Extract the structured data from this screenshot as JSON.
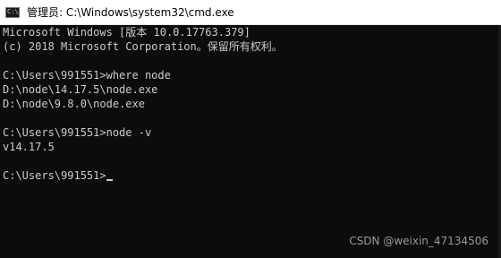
{
  "window": {
    "title": "管理员: C:\\Windows\\system32\\cmd.exe",
    "icon": "cmd-icon"
  },
  "console": {
    "lines": [
      "Microsoft Windows [版本 10.0.17763.379]",
      "(c) 2018 Microsoft Corporation。保留所有权利。",
      "",
      "C:\\Users\\991551>where node",
      "D:\\node\\14.17.5\\node.exe",
      "D:\\node\\9.8.0\\node.exe",
      "",
      "C:\\Users\\991551>node -v",
      "v14.17.5",
      "",
      "C:\\Users\\991551>"
    ]
  },
  "watermark": "CSDN @weixin_47134506"
}
